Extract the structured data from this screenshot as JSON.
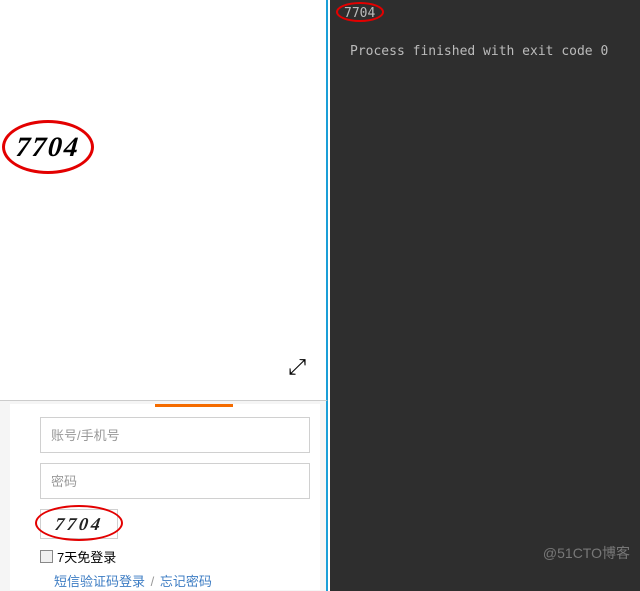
{
  "top_captcha": "7704",
  "login": {
    "username_placeholder": "账号/手机号",
    "password_placeholder": "密码",
    "captcha_value": "7704",
    "remember_label": "7天免登录",
    "sms_login": "短信验证码登录",
    "separator": "/",
    "forgot_password": "忘记密码"
  },
  "console": {
    "output_value": "7704",
    "process_line": "Process finished with exit code 0"
  },
  "watermark": "@51CTO博客"
}
